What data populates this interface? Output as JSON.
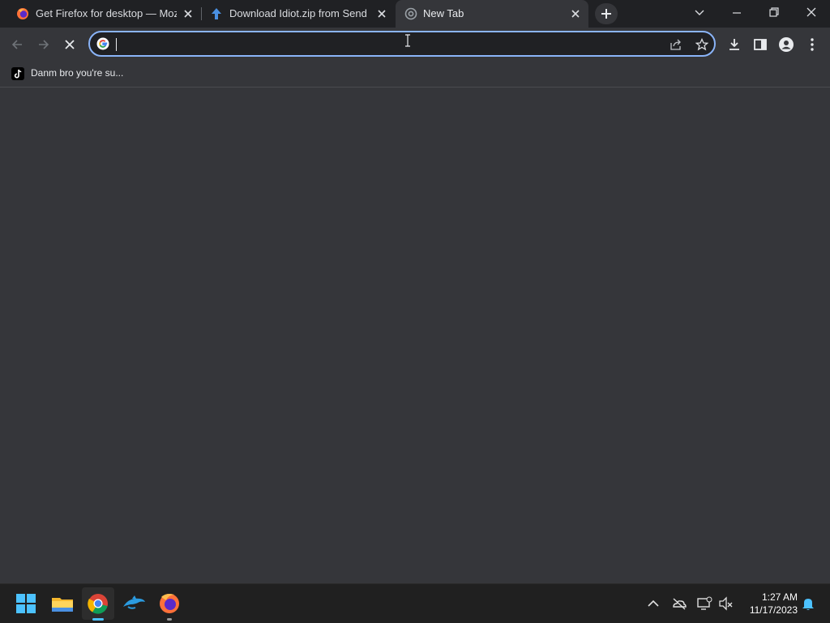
{
  "tabs": [
    {
      "title": "Get Firefox for desktop — Mozill",
      "icon": "firefox-icon"
    },
    {
      "title": "Download Idiot.zip from Sendsp",
      "icon": "upload-arrow-icon"
    },
    {
      "title": "New Tab",
      "icon": "chrome-icon",
      "active": true
    }
  ],
  "omnibox": {
    "value": "",
    "placeholder": ""
  },
  "bookmarks": [
    {
      "label": "Danm bro you're su...",
      "icon": "tiktok-icon"
    }
  ],
  "taskbar": {
    "time": "1:27 AM",
    "date": "11/17/2023"
  },
  "colors": {
    "accent": "#8ab4f8",
    "tabstrip": "#202124",
    "toolbar": "#35363a",
    "taskbar": "#202020"
  }
}
